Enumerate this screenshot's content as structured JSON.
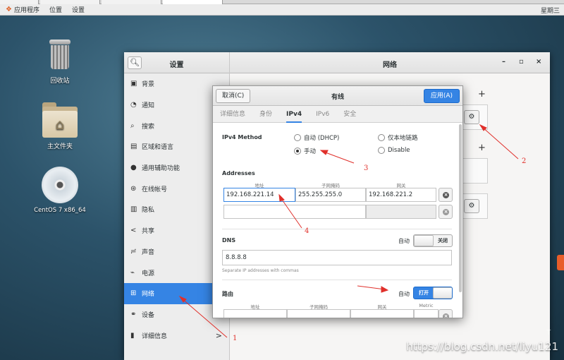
{
  "topbar": {
    "menus": [
      "应用程序",
      "位置",
      "设置"
    ],
    "clock": "星期三"
  },
  "desktop": {
    "icons": [
      {
        "label": "回收站",
        "icon": "trash-icon"
      },
      {
        "label": "主文件夹",
        "icon": "home-folder-icon"
      },
      {
        "label": "CentOS 7 x86_64",
        "icon": "disc-icon"
      }
    ]
  },
  "settings": {
    "sidebar_title": "设置",
    "main_title": "网络",
    "window_controls": [
      "–",
      "▫",
      "×"
    ],
    "items": [
      {
        "label": "背景",
        "icon": "display-icon"
      },
      {
        "label": "通知",
        "icon": "notification-icon"
      },
      {
        "label": "搜索",
        "icon": "search-icon"
      },
      {
        "label": "区域和语言",
        "icon": "region-icon"
      },
      {
        "label": "通用辅助功能",
        "icon": "accessibility-icon"
      },
      {
        "label": "在线帐号",
        "icon": "online-accounts-icon"
      },
      {
        "label": "隐私",
        "icon": "privacy-icon"
      },
      {
        "label": "共享",
        "icon": "share-icon"
      },
      {
        "label": "声音",
        "icon": "sound-icon"
      },
      {
        "label": "电源",
        "icon": "power-icon"
      },
      {
        "label": "网络",
        "icon": "network-icon",
        "active": true
      },
      {
        "label": "设备",
        "icon": "devices-icon",
        "arrow": ">"
      },
      {
        "label": "详细信息",
        "icon": "details-icon",
        "arrow": ">"
      }
    ]
  },
  "dialog": {
    "cancel": "取消(C)",
    "title": "有线",
    "apply": "应用(A)",
    "tabs": [
      "详细信息",
      "身份",
      "IPv4",
      "IPv6",
      "安全"
    ],
    "active_tab": "IPv4",
    "ipv4_method_label": "IPv4 Method",
    "methods": {
      "auto_dhcp": "自动 (DHCP)",
      "link_local": "仅本地链路",
      "manual": "手动",
      "disable": "Disable"
    },
    "selected_method": "手动",
    "addresses_label": "Addresses",
    "address_cols": [
      "地址",
      "子网掩码",
      "网关"
    ],
    "address_row": {
      "address": "192.168.221.14",
      "netmask": "255.255.255.0",
      "gateway": "192.168.221.2"
    },
    "dns_label": "DNS",
    "dns_auto_label": "自动",
    "dns_toggle": "关闭",
    "dns_value": "8.8.8.8",
    "dns_hint": "Separate IP addresses with commas",
    "routes_label": "路由",
    "routes_auto_label": "自动",
    "routes_toggle": "打开",
    "route_cols": [
      "地址",
      "子网掩码",
      "网关",
      "Metric"
    ]
  },
  "annotations": [
    "1",
    "2",
    "3",
    "4"
  ],
  "watermark": "https://blog.csdn.net/liyu121",
  "colors": {
    "accent": "#3584e4",
    "annotation": "#e0302b"
  }
}
